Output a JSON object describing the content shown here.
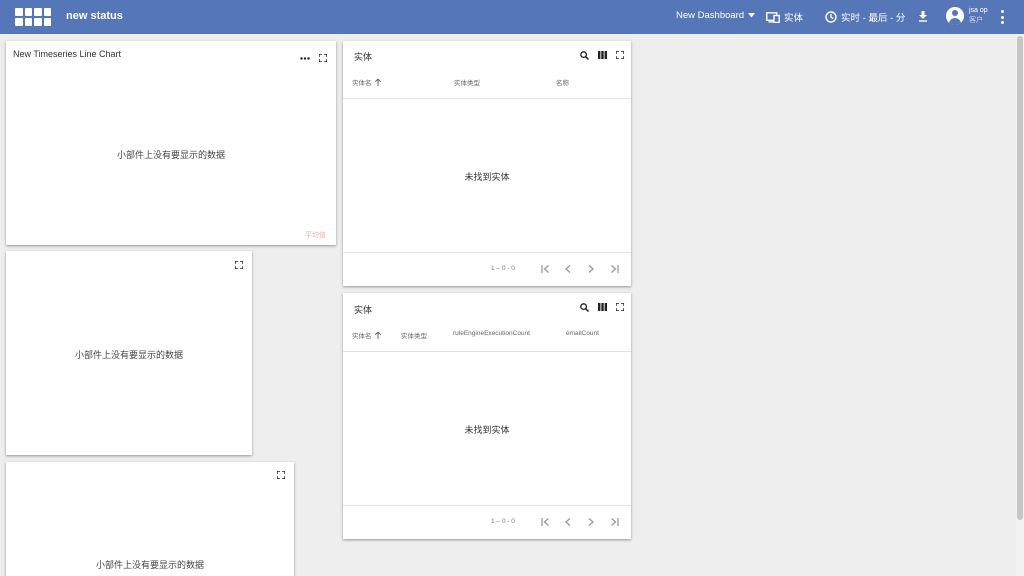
{
  "header": {
    "title": "new status",
    "dashboard_select": "New Dashboard",
    "entities_label": "实体",
    "timewindow_label": "实时 - 最后 - 分",
    "user_name": "jsa op",
    "user_role": "客户"
  },
  "widgets": {
    "line_chart": {
      "title": "New Timeseries Line Chart",
      "no_data": "小部件上没有要显示的数据",
      "legend_label": "平均值"
    },
    "card2": {
      "no_data": "小部件上没有要显示的数据"
    },
    "card3": {
      "no_data": "小部件上没有要显示的数据"
    },
    "table1": {
      "title": "实体",
      "columns": [
        "实体名",
        "实体类型",
        "名称"
      ],
      "empty": "未找到实体",
      "paging": "1 – 0 - 0"
    },
    "table2": {
      "title": "实体",
      "columns": [
        "实体名",
        "实体类型",
        "ruleEngineExecutionCount",
        "emailCount"
      ],
      "empty": "未找到实体",
      "paging": "1 – 0 - 0"
    }
  },
  "colors": {
    "topbar": "#5577b8",
    "background": "#eeeeee",
    "legend_faint": "#f3b2a8"
  }
}
